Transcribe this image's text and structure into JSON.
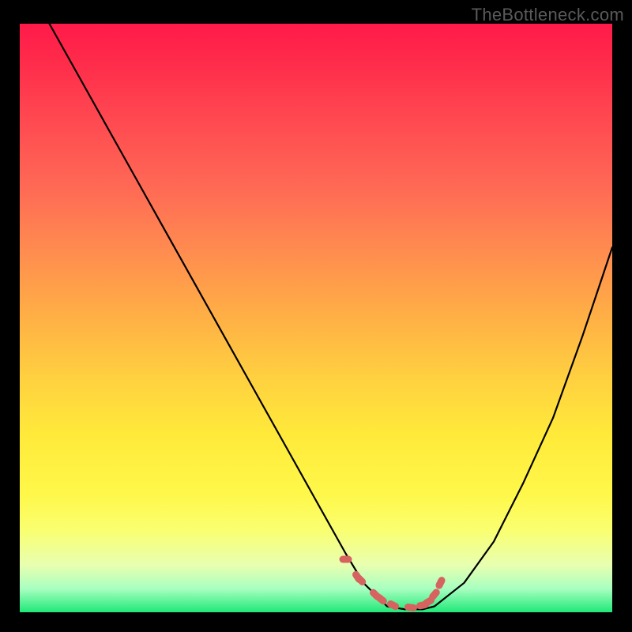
{
  "attribution": "TheBottleneck.com",
  "chart_data": {
    "type": "line",
    "title": "",
    "xlabel": "",
    "ylabel": "",
    "xlim": [
      0,
      100
    ],
    "ylim": [
      0,
      100
    ],
    "series": [
      {
        "name": "bottleneck-curve",
        "x": [
          5,
          10,
          15,
          20,
          25,
          30,
          35,
          40,
          45,
          50,
          55,
          58,
          60,
          62,
          65,
          68,
          70,
          75,
          80,
          85,
          90,
          95,
          100
        ],
        "values": [
          100,
          91,
          82,
          73,
          64,
          55,
          46,
          37,
          28,
          19,
          10,
          5,
          3,
          1,
          0.5,
          0.5,
          1,
          5,
          12,
          22,
          33,
          47,
          62
        ]
      }
    ],
    "trough_marker": {
      "name": "optimal-range",
      "color": "#d6635f",
      "points_xy": [
        [
          55,
          9
        ],
        [
          57,
          6
        ],
        [
          57.5,
          5.5
        ],
        [
          60,
          3
        ],
        [
          61,
          2.2
        ],
        [
          63,
          1.2
        ],
        [
          66,
          0.8
        ],
        [
          68,
          1.2
        ],
        [
          69,
          1.8
        ],
        [
          70,
          3
        ],
        [
          71,
          5
        ]
      ]
    }
  },
  "colors": {
    "curve": "#000000",
    "marker": "#d6635f",
    "page_bg": "#000000",
    "attribution_text": "#5a5a5a"
  }
}
